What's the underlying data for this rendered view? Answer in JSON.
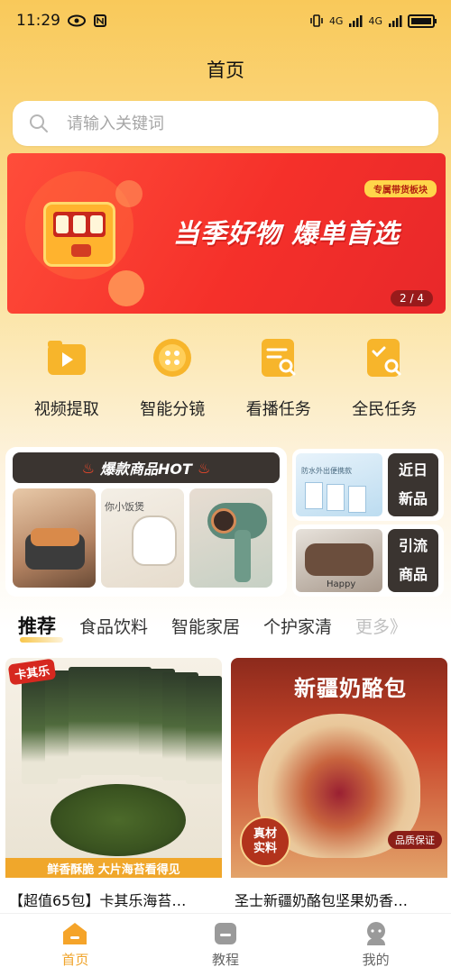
{
  "status_bar": {
    "time": "11:29",
    "network_1": "4G",
    "network_2": "4G"
  },
  "page": {
    "title": "首页"
  },
  "search": {
    "placeholder": "请输入关键词"
  },
  "banner": {
    "tag": "专属带货板块",
    "headline": "当季好物 爆单首选",
    "pager": "2 / 4"
  },
  "quick_actions": [
    {
      "label": "视频提取",
      "icon": "video-play-icon"
    },
    {
      "label": "智能分镜",
      "icon": "storyboard-icon"
    },
    {
      "label": "看播任务",
      "icon": "watch-task-icon"
    },
    {
      "label": "全民任务",
      "icon": "all-task-icon"
    }
  ],
  "hot_panel": {
    "title": "爆款商品HOT",
    "items": [
      {
        "caption": ""
      },
      {
        "caption": "你小饭煲"
      },
      {
        "caption": ""
      }
    ]
  },
  "side_cards": [
    {
      "label_line1": "近日",
      "label_line2": "新品",
      "thumb_caption": "防水外出便携款"
    },
    {
      "label_line1": "引流",
      "label_line2": "商品",
      "thumb_caption": "Happy"
    }
  ],
  "categories": [
    "推荐",
    "食品饮料",
    "智能家居",
    "个护家清",
    "更多》"
  ],
  "products": [
    {
      "title": "【超值65包】卡其乐海苔…",
      "logo": "卡其乐",
      "strip": "鲜香酥脆 大片海苔看得见"
    },
    {
      "title": "圣士新疆奶酪包坚果奶香…",
      "image_title": "新疆奶酪包",
      "stamp_line1": "真材",
      "stamp_line2": "实料",
      "badge": "品质保证"
    }
  ],
  "bottom_nav": [
    {
      "label": "首页",
      "active": true
    },
    {
      "label": "教程",
      "active": false
    },
    {
      "label": "我的",
      "active": false
    }
  ],
  "colors": {
    "accent": "#f0a42b",
    "banner_red": "#f5302a",
    "dark_label": "#3a3430"
  }
}
